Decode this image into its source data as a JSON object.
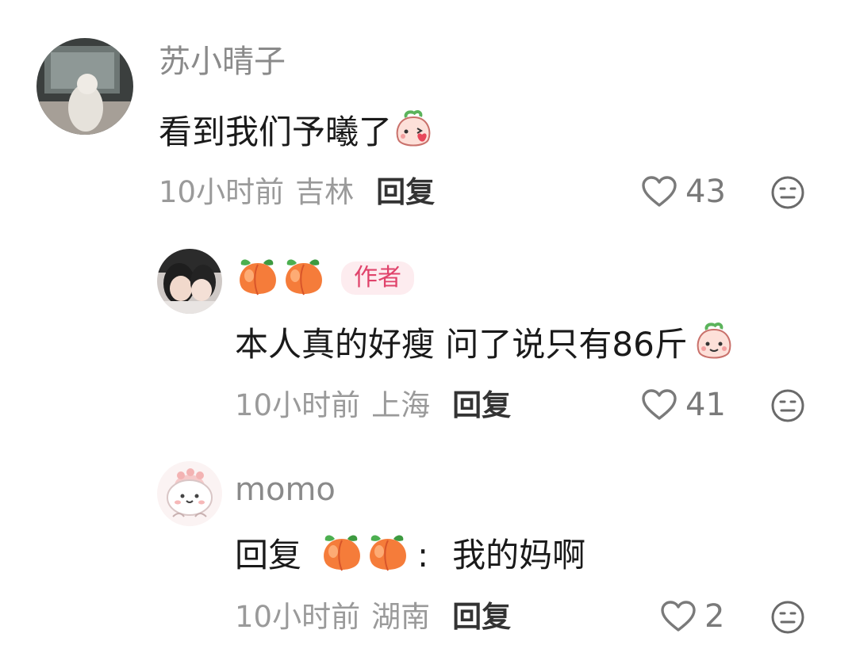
{
  "comments": [
    {
      "name": "苏小晴子",
      "text": "看到我们予曦了",
      "time": "10小时前",
      "location": "吉林",
      "reply_label": "回复",
      "likes": "43"
    },
    {
      "badge": "作者",
      "text": "本人真的好瘦 问了说只有86斤",
      "time": "10小时前",
      "location": "上海",
      "reply_label": "回复",
      "likes": "41"
    },
    {
      "name": "momo",
      "reply_prefix": "回复",
      "colon": ":",
      "text": "我的妈啊",
      "time": "10小时前",
      "location": "湖南",
      "reply_label": "回复",
      "likes": "2"
    }
  ],
  "icons": {
    "like": "heart-outline-icon",
    "dislike": "neutral-face-icon",
    "peach": "peach-emoji",
    "kiss": "peach-kiss-emoji",
    "smile": "peach-smile-emoji"
  },
  "colors": {
    "badge_bg": "#fdecef",
    "badge_text": "#e0436b",
    "meta": "#9a9a9a"
  }
}
